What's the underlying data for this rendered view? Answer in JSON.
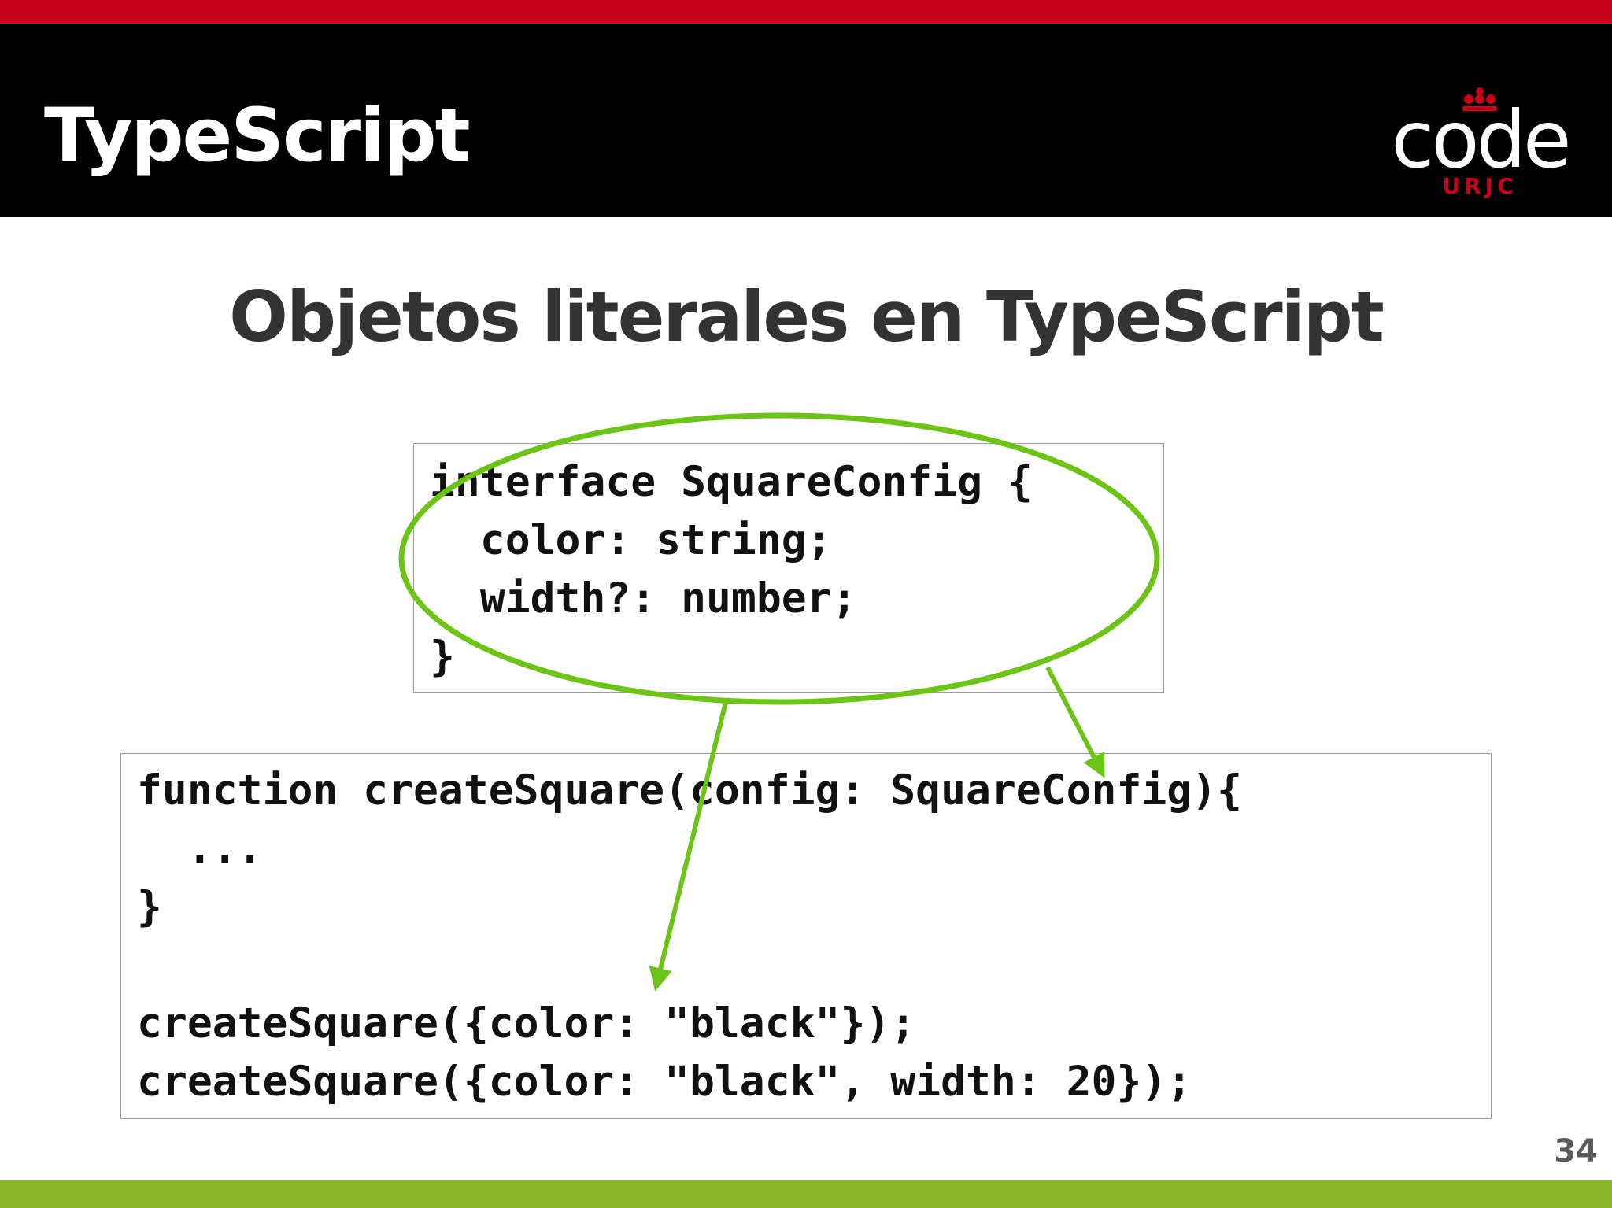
{
  "header": {
    "title": "TypeScript",
    "logo": {
      "word": "code",
      "subtitle": "URJC",
      "icon": "crown-icon"
    }
  },
  "slide": {
    "title": "Objetos literales en TypeScript",
    "page_number": "34"
  },
  "code_interface": {
    "lines": [
      "interface SquareConfig {",
      "  color: string;",
      "  width?: number;",
      "}"
    ]
  },
  "code_function": {
    "lines": [
      "function createSquare(config: SquareConfig){",
      "  ...",
      "}",
      "",
      "createSquare({color: \"black\"});",
      "createSquare({color: \"black\", width: 20});"
    ]
  },
  "colors": {
    "accent_red": "#c8001c",
    "header_black": "#000000",
    "annotation_green": "#6cc417",
    "footer_green": "#8ab92d"
  }
}
